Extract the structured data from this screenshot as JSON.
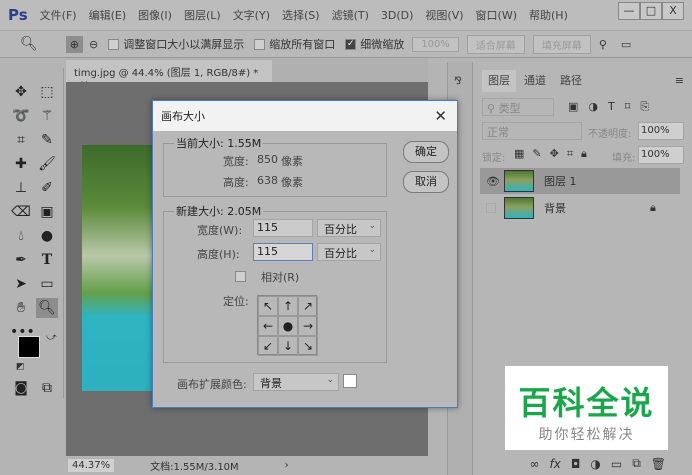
{
  "app": {
    "logo": "Ps",
    "menu": [
      "文件(F)",
      "编辑(E)",
      "图像(I)",
      "图层(L)",
      "文字(Y)",
      "选择(S)",
      "滤镜(T)",
      "3D(D)",
      "视图(V)",
      "窗口(W)",
      "帮助(H)"
    ],
    "win": [
      "—",
      "□",
      "X"
    ]
  },
  "options": {
    "resize_windows": "调整窗口大小以满屏显示",
    "zoom_all": "缩放所有窗口",
    "scrubby": "细微缩放",
    "zoom_value": "100%",
    "fit": "适合屏幕",
    "fill": "填充屏幕"
  },
  "document": {
    "tab": "timg.jpg @ 44.4% (图层 1, RGB/8#) *",
    "close": "×",
    "zoom": "44.37%",
    "docinfo": "文档:1.55M/3.10M",
    "arrow": "›"
  },
  "dialog": {
    "title": "画布大小",
    "close": "✕",
    "current_legend": "当前大小: 1.55M",
    "width_label": "宽度:",
    "width_value": "850",
    "height_label": "高度:",
    "height_value": "638",
    "unit_px": "像素",
    "new_legend": "新建大小: 2.05M",
    "new_width_label": "宽度(W):",
    "new_width": "115",
    "new_height_label": "高度(H):",
    "new_height": "115",
    "unit": "百分比",
    "relative": "相对(R)",
    "anchor_label": "定位:",
    "anchor": [
      "↖",
      "↑",
      "↗",
      "←",
      "●",
      "→",
      "↙",
      "↓",
      "↘"
    ],
    "ext_color_label": "画布扩展颜色:",
    "ext_color": "背景",
    "ok": "确定",
    "cancel": "取消"
  },
  "layers": {
    "tabs": [
      "图层",
      "通道",
      "路径"
    ],
    "filter": "类型",
    "blend": "正常",
    "opacity_label": "不透明度:",
    "opacity": "100%",
    "lock_label": "锁定:",
    "fill_label": "填充:",
    "fill": "100%",
    "items": [
      {
        "name": "图层 1"
      },
      {
        "name": "背景"
      }
    ]
  },
  "watermark": {
    "title": "百科全说",
    "subtitle": "助你轻松解决"
  }
}
